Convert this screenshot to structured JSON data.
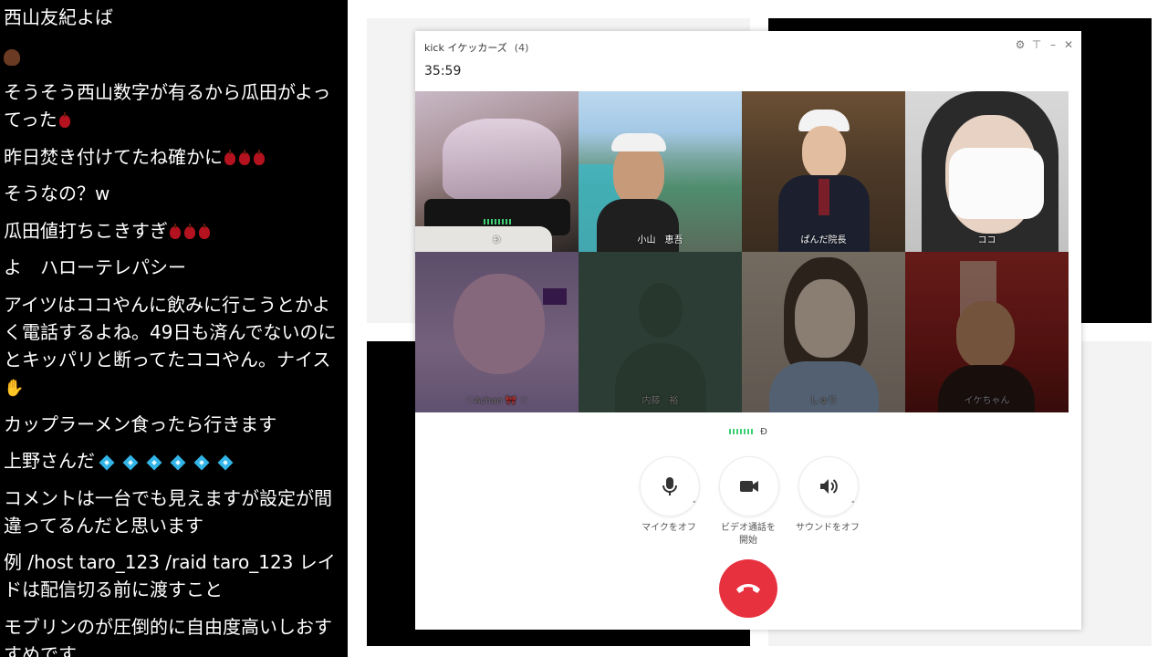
{
  "chat": {
    "messages": [
      "西山友紀よば",
      "",
      "そうそう西山数字が有るから瓜田がよってった",
      "昨日焚き付けてたね確かに",
      "そうなの？w",
      "瓜田値打ちこきすぎ",
      "よ　ハローテレパシー",
      "アイツはココやんに飲みに行こうとかよく電話するよね。49日も済んでないのにとキッパリと断ってたココやん。ナイス",
      "カップラーメン食ったら行きます",
      "上野さんだ",
      "コメントは一台でも見えますが設定が間違ってるんだと思います",
      "例 /host taro_123  /raid taro_123 レイドは配信切る前に渡すこと",
      "モブリンのが圧倒的に自由度高いしおすすめです"
    ],
    "emoji": {
      "cherry": "cherry-emoji",
      "diamond": "diamond-emoji",
      "clap": "clapping-hands-emoji",
      "face": "avatar-emoji"
    }
  },
  "call": {
    "title": "kick イケッカーズ",
    "participant_count": "(4)",
    "timer": "35:59",
    "controls": {
      "settings_icon": "gear-icon",
      "pin_icon": "pin-icon",
      "minimize_icon": "minimize-icon",
      "close_icon": "close-icon"
    },
    "participants": [
      {
        "name": "Đ",
        "video": true,
        "speaking": true
      },
      {
        "name": "小山　恵吾",
        "video": true,
        "speaking": false
      },
      {
        "name": "ぱんだ院長",
        "video": true,
        "speaking": false
      },
      {
        "name": "ココ",
        "video": true,
        "speaking": false
      },
      {
        "name": "♡Achan 🎀 ♡",
        "video": true,
        "speaking": false
      },
      {
        "name": "内藤　裕",
        "video": false,
        "speaking": false
      },
      {
        "name": "しゅり",
        "video": true,
        "speaking": false
      },
      {
        "name": "イケちゃん",
        "video": true,
        "speaking": false
      }
    ],
    "active_speaker": "Đ",
    "buttons": {
      "mic": {
        "label": "マイクをオフ",
        "icon": "microphone-icon"
      },
      "video": {
        "label_line1": "ビデオ通話を",
        "label_line2": "開始",
        "icon": "video-camera-icon"
      },
      "sound": {
        "label": "サウンドをオフ",
        "icon": "speaker-icon"
      },
      "hangup": {
        "icon": "phone-hangup-icon"
      }
    },
    "colors": {
      "hangup": "#e8313f",
      "speaking_indicator": "#3ecf75"
    }
  }
}
